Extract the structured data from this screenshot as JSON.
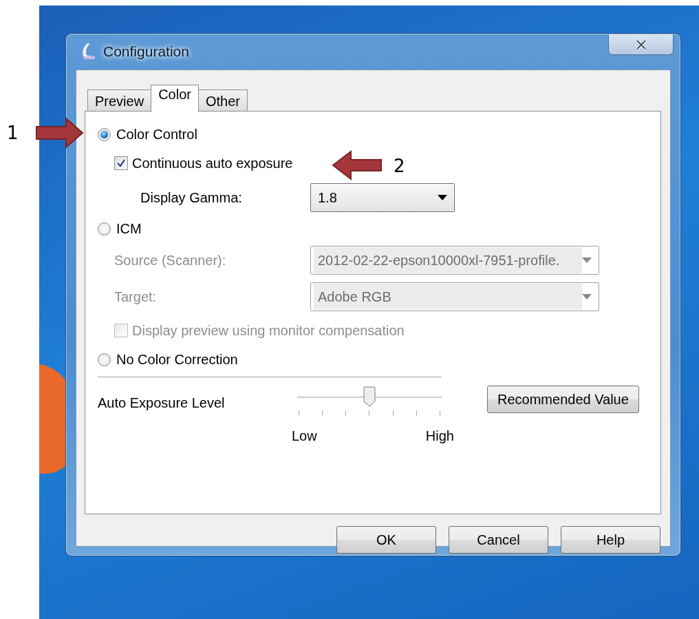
{
  "window": {
    "title": "Configuration"
  },
  "tabs": [
    {
      "label": "Preview",
      "selected": false
    },
    {
      "label": "Color",
      "selected": true
    },
    {
      "label": "Other",
      "selected": false
    }
  ],
  "sections": [
    {
      "label": "Color Control",
      "selected": true,
      "controls": [
        {
          "kind": "checkbox",
          "label": "Continuous auto exposure",
          "checked": true,
          "disabled": false
        },
        {
          "kind": "dropdown",
          "label": "Display Gamma:",
          "value": "1.8",
          "disabled": false
        }
      ]
    },
    {
      "label": "ICM",
      "selected": false,
      "controls": [
        {
          "kind": "dropdown",
          "label": "Source (Scanner):",
          "value": "2012-02-22-epson10000xl-7951-profile.",
          "disabled": true
        },
        {
          "kind": "dropdown",
          "label": "Target:",
          "value": "Adobe RGB",
          "disabled": true
        },
        {
          "kind": "checkbox",
          "label": "Display preview using monitor compensation",
          "checked": false,
          "disabled": true
        }
      ]
    },
    {
      "label": "No Color Correction",
      "selected": false
    }
  ],
  "exposure": {
    "label": "Auto Exposure Level",
    "level": 0.5,
    "min_label": "Low",
    "max_label": "High",
    "button": "Recommended Value"
  },
  "buttons": [
    {
      "label": "OK"
    },
    {
      "label": "Cancel"
    },
    {
      "label": "Help"
    }
  ],
  "annotations": [
    {
      "label": "1"
    },
    {
      "label": "2"
    }
  ]
}
